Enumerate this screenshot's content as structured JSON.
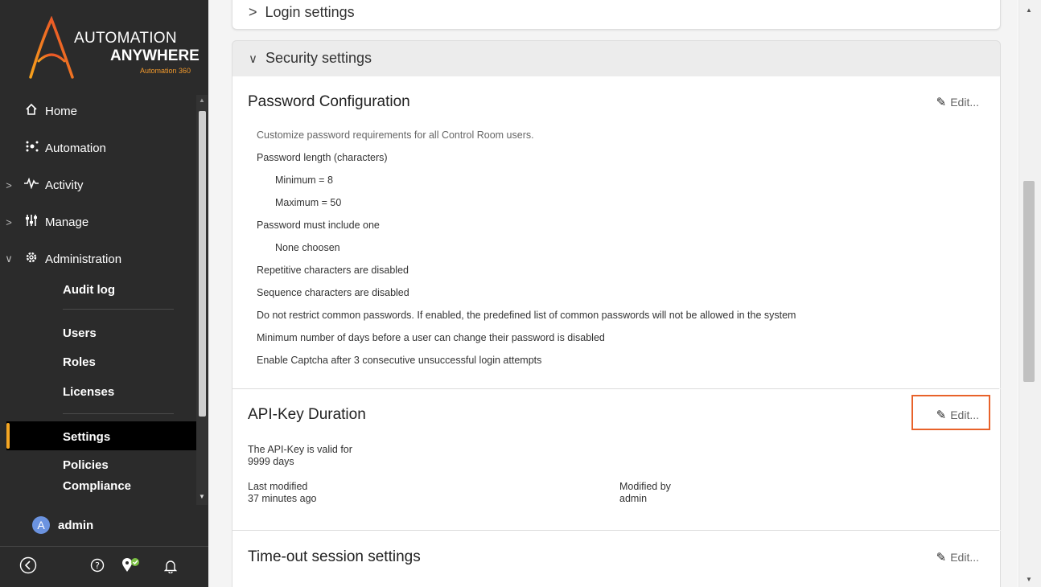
{
  "sidebar": {
    "logo": {
      "line1": "AUTOMATION",
      "line2": "ANYWHERE",
      "line3": "Automation 360"
    },
    "nav": [
      {
        "label": "Home",
        "icon": "home-icon"
      },
      {
        "label": "Automation",
        "icon": "automation-icon"
      },
      {
        "label": "Activity",
        "icon": "activity-icon"
      },
      {
        "label": "Manage",
        "icon": "manage-icon"
      },
      {
        "label": "Administration",
        "icon": "gear-icon"
      }
    ],
    "admin_sub": [
      "Audit log",
      "Users",
      "Roles",
      "Licenses",
      "Settings",
      "Policies",
      "Compliance"
    ],
    "user": {
      "initial": "A",
      "name": "admin"
    },
    "accent": "#f5a623"
  },
  "main": {
    "login_settings": "Login settings",
    "security_settings": "Security settings",
    "password": {
      "title": "Password Configuration",
      "edit": "Edit...",
      "description": "Customize password requirements for all Control Room users.",
      "length_label": "Password length (characters)",
      "minimum": "Minimum = 8",
      "maximum": "Maximum = 50",
      "include_label": "Password must include one",
      "include_value": "None choosen",
      "repetitive": "Repetitive characters are disabled",
      "sequence": "Sequence characters are disabled",
      "common": "Do not restrict common passwords. If enabled, the predefined list of common passwords will not be allowed in the system",
      "min_days": "Minimum number of days before a user can change their password is disabled",
      "captcha": "Enable Captcha after 3 consecutive unsuccessful login attempts"
    },
    "api_key": {
      "title": "API-Key Duration",
      "edit": "Edit...",
      "valid_label": "The API-Key is valid for",
      "valid_value": "9999 days",
      "last_modified_label": "Last modified",
      "last_modified_value": "37 minutes ago",
      "modified_by_label": "Modified by",
      "modified_by_value": "admin"
    },
    "timeout": {
      "title": "Time-out session settings",
      "edit": "Edit..."
    }
  },
  "highlight_color": "#e8622a"
}
